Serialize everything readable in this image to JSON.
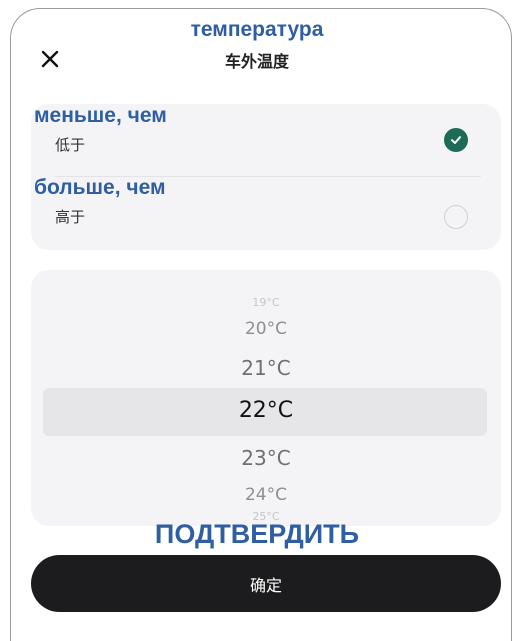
{
  "header": {
    "title_ru": "температура",
    "title_cn": "车外温度",
    "close_icon": "close-icon"
  },
  "options": [
    {
      "label_ru": "меньше, чем",
      "label_cn": "低于",
      "selected": true
    },
    {
      "label_ru": "больше, чем",
      "label_cn": "高于",
      "selected": false
    }
  ],
  "picker": {
    "items": [
      "19°C",
      "20°C",
      "21°C",
      "22°C",
      "23°C",
      "24°C",
      "25°C"
    ],
    "selected": "22°C"
  },
  "confirm": {
    "label_ru": "ПОДТВЕРДИТЬ",
    "label_cn": "确定"
  },
  "colors": {
    "annotation": "#2f5ea3",
    "check_fill": "#1d6b57",
    "button_bg": "#1c1c1e",
    "card_bg": "#f4f4f6"
  }
}
